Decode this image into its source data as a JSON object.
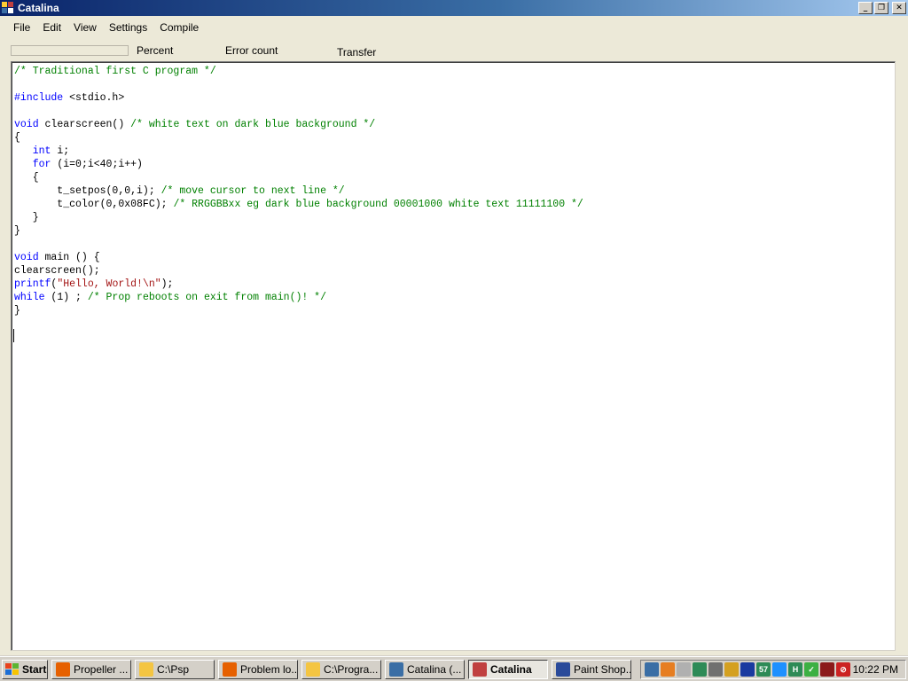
{
  "window": {
    "title": "Catalina",
    "controls": [
      "_",
      "❐",
      "✕"
    ]
  },
  "menu": [
    "File",
    "Edit",
    "View",
    "Settings",
    "Compile"
  ],
  "status": {
    "progress_value": 0,
    "percent_label": "Percent",
    "error_label": "Error count",
    "transfer_label": "Transfer"
  },
  "code_lines": [
    [
      [
        "comment",
        "/* Traditional first C program */"
      ]
    ],
    [],
    [
      [
        "pre",
        "#include"
      ],
      [
        "plain",
        " <stdio.h>"
      ]
    ],
    [],
    [
      [
        "keyword",
        "void"
      ],
      [
        "plain",
        " clearscreen() "
      ],
      [
        "comment",
        "/* white text on dark blue background */"
      ]
    ],
    [
      [
        "plain",
        "{"
      ]
    ],
    [
      [
        "plain",
        "   "
      ],
      [
        "keyword",
        "int"
      ],
      [
        "plain",
        " i;"
      ]
    ],
    [
      [
        "plain",
        "   "
      ],
      [
        "keyword",
        "for"
      ],
      [
        "plain",
        " (i=0;i<40;i++)"
      ]
    ],
    [
      [
        "plain",
        "   {"
      ]
    ],
    [
      [
        "plain",
        "       t_setpos(0,0,i); "
      ],
      [
        "comment",
        "/* move cursor to next line */"
      ]
    ],
    [
      [
        "plain",
        "       t_color(0,0x08FC); "
      ],
      [
        "comment",
        "/* RRGGBBxx eg dark blue background 00001000 white text 11111100 */"
      ]
    ],
    [
      [
        "plain",
        "   }"
      ]
    ],
    [
      [
        "plain",
        "}"
      ]
    ],
    [],
    [
      [
        "keyword",
        "void"
      ],
      [
        "plain",
        " main () {"
      ]
    ],
    [
      [
        "plain",
        "clearscreen();"
      ]
    ],
    [
      [
        "keyword",
        "printf"
      ],
      [
        "plain",
        "("
      ],
      [
        "string",
        "\"Hello, World!\\n\""
      ],
      [
        "plain",
        ");"
      ]
    ],
    [
      [
        "keyword",
        "while"
      ],
      [
        "plain",
        " (1) ; "
      ],
      [
        "comment",
        "/* Prop reboots on exit from main()! */"
      ]
    ],
    [
      [
        "plain",
        "}"
      ]
    ]
  ],
  "taskbar": {
    "start_label": "Start",
    "tasks": [
      {
        "label": "Propeller ...",
        "icon": "firefox-icon",
        "color": "#e66000",
        "active": false
      },
      {
        "label": "C:\\Psp",
        "icon": "folder-icon",
        "color": "#f4c542",
        "active": false
      },
      {
        "label": "Problem lo...",
        "icon": "firefox-icon",
        "color": "#e66000",
        "active": false
      },
      {
        "label": "C:\\Progra...",
        "icon": "folder-icon",
        "color": "#f4c542",
        "active": false
      },
      {
        "label": "Catalina (...",
        "icon": "console-icon",
        "color": "#3a6ea5",
        "active": false
      },
      {
        "label": "Catalina",
        "icon": "catalina-icon",
        "color": "#c04040",
        "active": true
      },
      {
        "label": "Paint Shop...",
        "icon": "paint-shop-icon",
        "color": "#2a4a9a",
        "active": false
      }
    ],
    "tray": {
      "icons": [
        {
          "name": "network-icon",
          "color": "#3a6ea5",
          "text": ""
        },
        {
          "name": "java-icon",
          "color": "#e67e22",
          "text": ""
        },
        {
          "name": "display-icon",
          "color": "#b0b0b0",
          "text": ""
        },
        {
          "name": "usb-icon",
          "color": "#2e8b57",
          "text": ""
        },
        {
          "name": "speaker-icon",
          "color": "#707070",
          "text": ""
        },
        {
          "name": "tool-icon",
          "color": "#d4a020",
          "text": ""
        },
        {
          "name": "monitor-icon",
          "color": "#1a3aa0",
          "text": ""
        },
        {
          "name": "counter-icon",
          "color": "#2e8b57",
          "text": "57"
        },
        {
          "name": "messenger-icon",
          "color": "#1e90ff",
          "text": ""
        },
        {
          "name": "app-h-icon",
          "color": "#2e8b57",
          "text": "H"
        },
        {
          "name": "shield-check-icon",
          "color": "#3cb043",
          "text": "✓"
        },
        {
          "name": "meter-icon",
          "color": "#8b1a1a",
          "text": ""
        },
        {
          "name": "blocked-icon",
          "color": "#cc2222",
          "text": "⊘"
        }
      ],
      "clock": "10:22 PM"
    }
  }
}
